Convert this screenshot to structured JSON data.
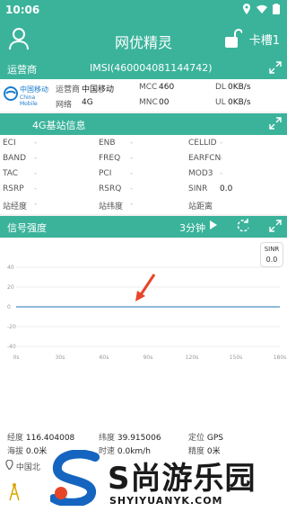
{
  "status_bar": {
    "time": "10:06",
    "icons": [
      "location-icon",
      "wifi-icon",
      "battery-icon"
    ]
  },
  "app_bar": {
    "title": "网优精灵",
    "slot": "卡槽1"
  },
  "operator_section": {
    "header_label": "运营商",
    "imsi": "IMSI(460004081144742)",
    "brand_cn": "中国移动",
    "brand_en": "China Mobile",
    "operator_key": "运营商",
    "operator_value": "中国移动",
    "network_key": "网络",
    "network_value": "4G",
    "mcc_key": "MCC",
    "mcc_value": "460",
    "mnc_key": "MNC",
    "mnc_value": "00",
    "dl_key": "DL",
    "dl_value": "0KB/s",
    "ul_key": "UL",
    "ul_value": "0KB/s"
  },
  "lte_section": {
    "header_label": "4G基站信息",
    "fields": [
      {
        "key": "ECI",
        "value": "-"
      },
      {
        "key": "ENB",
        "value": "-"
      },
      {
        "key": "CELLID",
        "value": "-"
      },
      {
        "key": "BAND",
        "value": "-"
      },
      {
        "key": "FREQ",
        "value": "-"
      },
      {
        "key": "EARFCN",
        "value": "-"
      },
      {
        "key": "TAC",
        "value": "-"
      },
      {
        "key": "PCI",
        "value": "-"
      },
      {
        "key": "MOD3",
        "value": "-"
      },
      {
        "key": "RSRP",
        "value": "-"
      },
      {
        "key": "RSRQ",
        "value": "-"
      },
      {
        "key": "SINR",
        "value": "0.0"
      },
      {
        "key": "站经度",
        "value": "-"
      },
      {
        "key": "站纬度",
        "value": "-"
      },
      {
        "key": "站距离",
        "value": ""
      }
    ]
  },
  "signal_section": {
    "header_label": "信号强度",
    "duration": "3分钟",
    "sinr_label": "SINR",
    "sinr_value": "0.0"
  },
  "chart_data": {
    "type": "line",
    "x": [
      "0s",
      "30s",
      "60s",
      "90s",
      "120s",
      "150s",
      "180s"
    ],
    "y_ticks": [
      "40",
      "20",
      "0",
      "-20",
      "-40"
    ],
    "ylim": [
      -40,
      40
    ],
    "series": [
      {
        "values": [
          0,
          0,
          0,
          0,
          0,
          0,
          0
        ]
      }
    ],
    "grid": true
  },
  "bottom_info": {
    "lon_key": "经度",
    "lon_value": "116.404008",
    "lat_key": "纬度",
    "lat_value": "39.915006",
    "loc_key": "定位",
    "loc_value": "GPS",
    "alt_key": "海拔",
    "alt_value": "0.0米",
    "speed_key": "时速",
    "speed_value": "0.0km/h",
    "acc_key": "精度",
    "acc_value": "0米",
    "address": "中国北"
  },
  "watermark": {
    "text": "S尚游乐园",
    "sub": "SHYIYUANYK.COM"
  },
  "colors": {
    "primary": "#3bb39b",
    "line": "#4a90c2",
    "arrow": "#e8442a"
  }
}
